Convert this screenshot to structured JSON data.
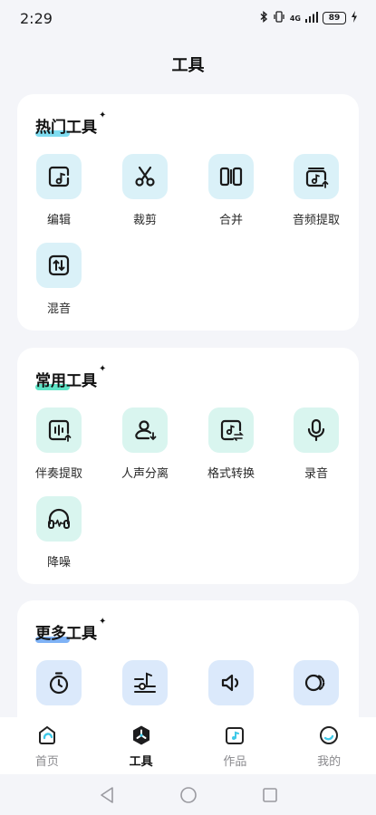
{
  "status": {
    "time": "2:29",
    "signal_label": "4G",
    "battery": "89"
  },
  "page": {
    "title": "工具"
  },
  "sections": {
    "hot": {
      "title": "热门工具",
      "accent": "#3fc9e8",
      "tools": [
        {
          "label": "编辑",
          "icon": "edit-note-icon"
        },
        {
          "label": "裁剪",
          "icon": "scissors-icon"
        },
        {
          "label": "合并",
          "icon": "merge-icon"
        },
        {
          "label": "音频提取",
          "icon": "audio-extract-icon"
        },
        {
          "label": "混音",
          "icon": "mix-icon"
        }
      ]
    },
    "common": {
      "title": "常用工具",
      "accent": "#2fd6b4",
      "tools": [
        {
          "label": "伴奏提取",
          "icon": "accompaniment-extract-icon"
        },
        {
          "label": "人声分离",
          "icon": "voice-separate-icon"
        },
        {
          "label": "格式转换",
          "icon": "format-convert-icon"
        },
        {
          "label": "录音",
          "icon": "microphone-icon"
        },
        {
          "label": "降噪",
          "icon": "headphones-denoise-icon"
        }
      ]
    },
    "more": {
      "title": "更多工具",
      "accent": "#4a8df0",
      "tools": [
        {
          "label": "",
          "icon": "timer-icon"
        },
        {
          "label": "",
          "icon": "equalizer-note-icon"
        },
        {
          "label": "",
          "icon": "volume-icon"
        },
        {
          "label": "",
          "icon": "overlap-circles-icon"
        }
      ]
    }
  },
  "nav": {
    "items": [
      {
        "label": "首页",
        "icon": "home-icon"
      },
      {
        "label": "工具",
        "icon": "tools-icon"
      },
      {
        "label": "作品",
        "icon": "works-icon"
      },
      {
        "label": "我的",
        "icon": "profile-icon"
      }
    ],
    "active_index": 1
  }
}
